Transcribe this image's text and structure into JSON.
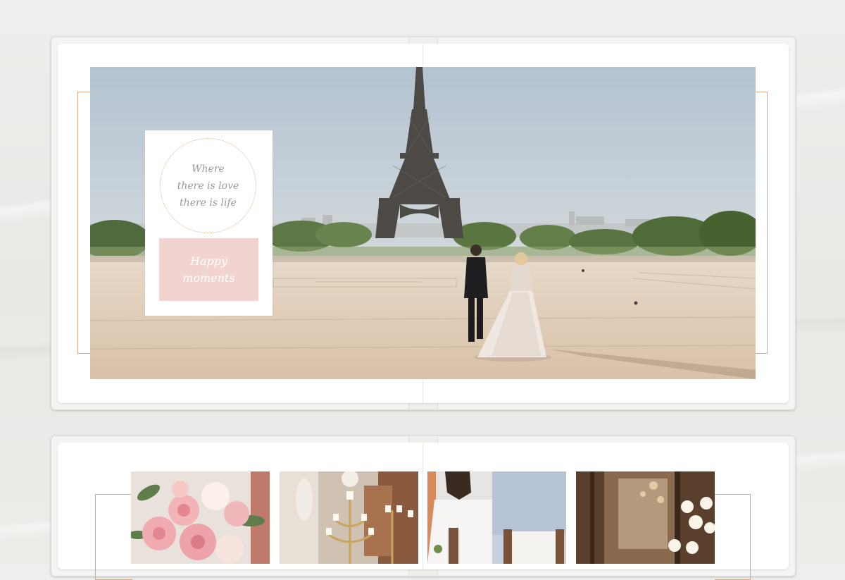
{
  "quote_card": {
    "quote": "Where\nthere is love\nthere is life",
    "caption": "Happy\nmoments"
  },
  "colors": {
    "accent_gold": "#d8a988",
    "blush": "#f1d4cf",
    "page": "#ffffff"
  },
  "photos": {
    "hero": "eiffel-tower-wedding-couple",
    "thumbnails": [
      "peony-bouquet",
      "candelabra",
      "bride-and-groom",
      "venue-lights"
    ]
  }
}
